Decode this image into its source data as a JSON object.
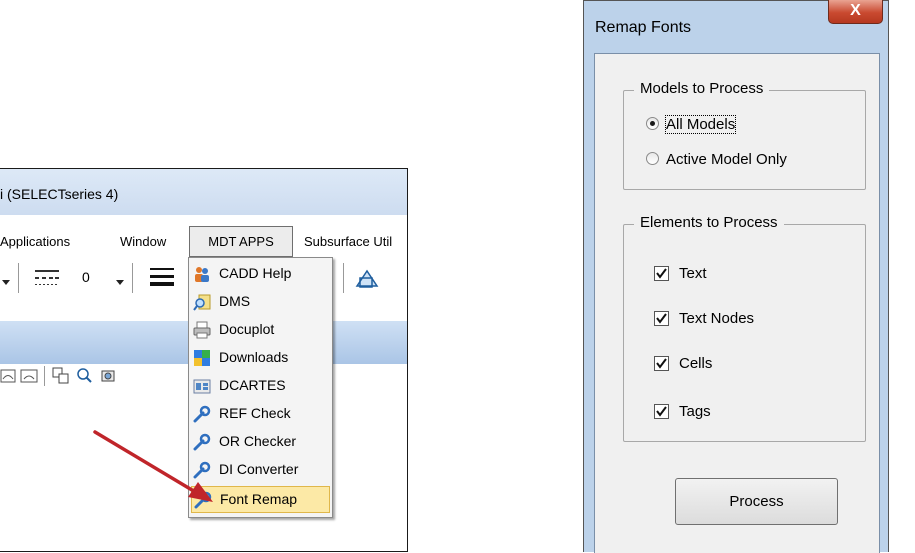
{
  "main_window": {
    "title": "i (SELECTseries 4)",
    "menu": {
      "applications": "Applications",
      "window": "Window",
      "mdt_apps": "MDT APPS",
      "subsurface": "Subsurface Util"
    },
    "toolbar": {
      "value": "0"
    },
    "mdt_menu_items": [
      {
        "label": "CADD Help",
        "icon": "people-help-icon"
      },
      {
        "label": "DMS",
        "icon": "magnifier-document-icon"
      },
      {
        "label": "Docuplot",
        "icon": "printer-icon"
      },
      {
        "label": "Downloads",
        "icon": "grid-color-icon"
      },
      {
        "label": "DCARTES",
        "icon": "cards-icon"
      },
      {
        "label": "REF Check",
        "icon": "wrench-icon"
      },
      {
        "label": "OR Checker",
        "icon": "wrench-icon"
      },
      {
        "label": "DI Converter",
        "icon": "wrench-icon"
      },
      {
        "label": "Font Remap",
        "icon": "wrench-icon"
      }
    ],
    "highlighted_item": "Font Remap",
    "arrow_color": "#c0252a"
  },
  "dialog": {
    "title": "Remap Fonts",
    "close_label": "X",
    "models_group": {
      "legend": "Models to Process",
      "options": [
        {
          "label": "All Models",
          "selected": true
        },
        {
          "label": "Active Model Only",
          "selected": false
        }
      ]
    },
    "elements_group": {
      "legend": "Elements to Process",
      "items": [
        {
          "label": "Text",
          "checked": true
        },
        {
          "label": "Text Nodes",
          "checked": true
        },
        {
          "label": "Cells",
          "checked": true
        },
        {
          "label": "Tags",
          "checked": true
        }
      ]
    },
    "process_label": "Process"
  }
}
